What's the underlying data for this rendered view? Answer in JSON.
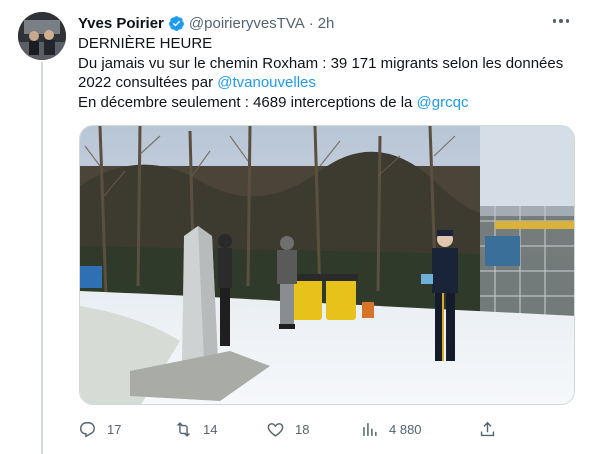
{
  "author": {
    "name": "Yves Poirier",
    "handle": "@poirieryvesTVA",
    "time": "2h",
    "separator": "·"
  },
  "tweet": {
    "line1": "DERNIÈRE HEURE",
    "line2": "Du jamais vu sur le chemin Roxham : 39 171 migrants selon les données",
    "line3_prefix": "2022 consultées par ",
    "line3_link": "@tvanouvelles",
    "line4_prefix": "En décembre seulement : 4689 interceptions de la ",
    "line4_link": "@grcqc"
  },
  "actions": {
    "replies": "17",
    "retweets": "14",
    "likes": "18",
    "views": "4 880"
  },
  "colors": {
    "accent": "#1d9bf0",
    "muted": "#536471",
    "text": "#0f1419"
  },
  "icons": [
    "verified-badge-icon",
    "more-icon",
    "reply-icon",
    "retweet-icon",
    "like-icon",
    "views-icon",
    "share-icon"
  ]
}
